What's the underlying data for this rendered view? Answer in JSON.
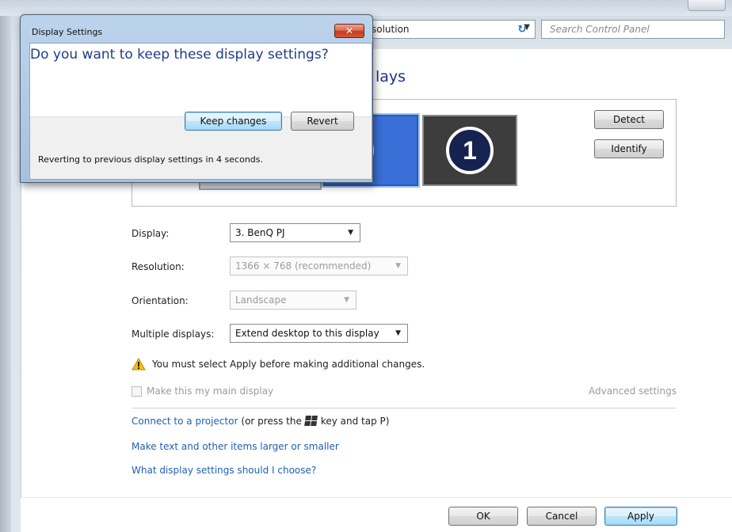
{
  "control_panel": {
    "address_text": "solution",
    "search_placeholder": "Search Control Panel",
    "heading": "lays",
    "detect_button": "Detect",
    "identify_button": "Identify",
    "monitors": [
      {
        "number": "3",
        "selected": true
      },
      {
        "number": "1",
        "selected": false
      }
    ],
    "display_label": "Display:",
    "display_value": "3. BenQ PJ",
    "resolution_label": "Resolution:",
    "resolution_value": "1366 × 768 (recommended)",
    "orientation_label": "Orientation:",
    "orientation_value": "Landscape",
    "multiple_label": "Multiple displays:",
    "multiple_value": "Extend desktop to this display",
    "warning_text": "You must select Apply before making additional changes.",
    "main_display_label": "Make this my main display",
    "advanced_settings": "Advanced settings",
    "projector_link": "Connect to a projector",
    "projector_suffix_pre": "(or press the",
    "projector_suffix_post": "key and tap P)",
    "text_size_link": "Make text and other items larger or smaller",
    "which_settings_link": "What display settings should I choose?",
    "ok_button": "OK",
    "cancel_button": "Cancel",
    "apply_button": "Apply"
  },
  "dialog": {
    "title": "Display Settings",
    "question": "Do you want to keep these display settings?",
    "keep_button": "Keep changes",
    "revert_button": "Revert",
    "countdown": "Reverting to previous display settings in 4 seconds."
  },
  "colors": {
    "link": "#1f5fb5",
    "heading": "#1e3287",
    "close_button": "#c7391d",
    "selected_monitor": "#3a6fd8"
  }
}
